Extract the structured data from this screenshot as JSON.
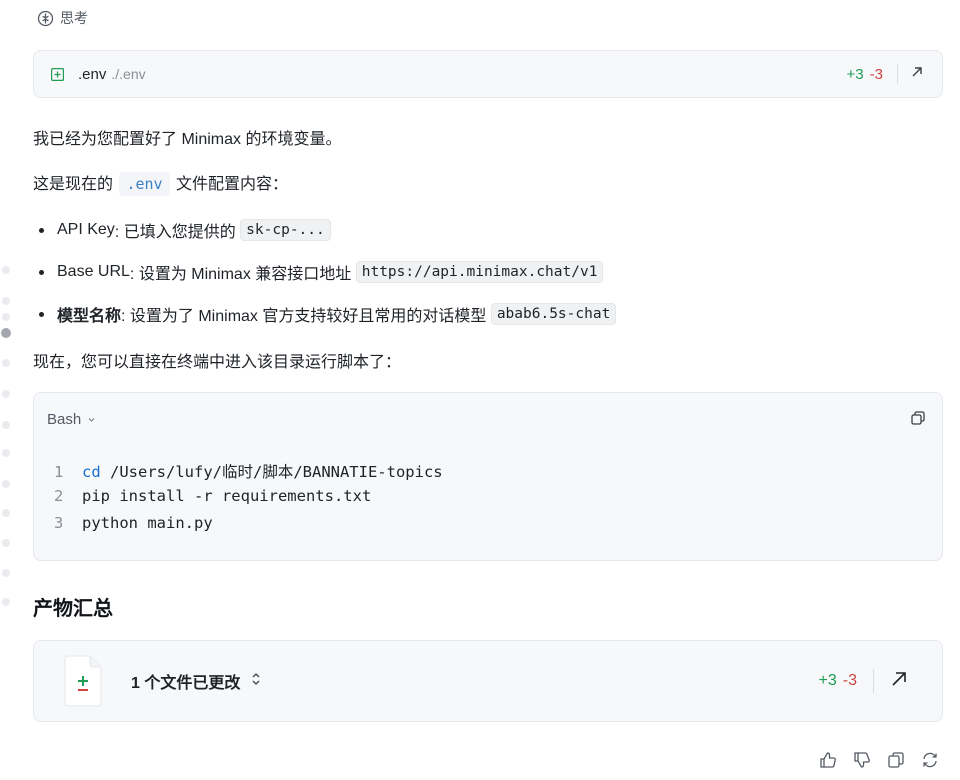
{
  "thinking": {
    "label": "思考",
    "icon": "brain-icon"
  },
  "file_change": {
    "name": ".env",
    "path": "./.env",
    "added": "+3",
    "removed": "-3",
    "icon": "file-added-icon",
    "open_icon": "arrow-up-right-icon"
  },
  "message": {
    "line1": "我已经为您配置好了 Minimax 的环境变量。",
    "line2_pre": "这是现在的",
    "line2_code": ".env",
    "line2_post": "文件配置内容：",
    "bullets": [
      {
        "key": "API Key",
        "text": ": 已填入您提供的",
        "code": "sk-cp-..."
      },
      {
        "key": "Base URL",
        "text": ": 设置为 Minimax 兼容接口地址",
        "code": "https://api.minimax.chat/v1"
      },
      {
        "key": "模型名称",
        "text": ": 设置为了 Minimax 官方支持较好且常用的对话模型",
        "code": "abab6.5s-chat"
      }
    ],
    "line3": "现在，您可以直接在终端中进入该目录运行脚本了："
  },
  "code_block": {
    "language": "Bash",
    "lines": [
      {
        "num": "1",
        "kw": "cd",
        "rest": " /Users/lufy/临时/脚本/BANNATIE-topics"
      },
      {
        "num": "2",
        "kw": "",
        "rest": "pip install -r requirements.txt"
      },
      {
        "num": "3",
        "kw": "",
        "rest": "python main.py"
      }
    ]
  },
  "summary": {
    "heading": "产物汇总",
    "label": "1 个文件已更改",
    "added": "+3",
    "removed": "-3"
  },
  "colors": {
    "added": "#1f9d55",
    "removed": "#d14343",
    "keyword": "#1a6fd1",
    "inline_code": "#3b82c4"
  }
}
